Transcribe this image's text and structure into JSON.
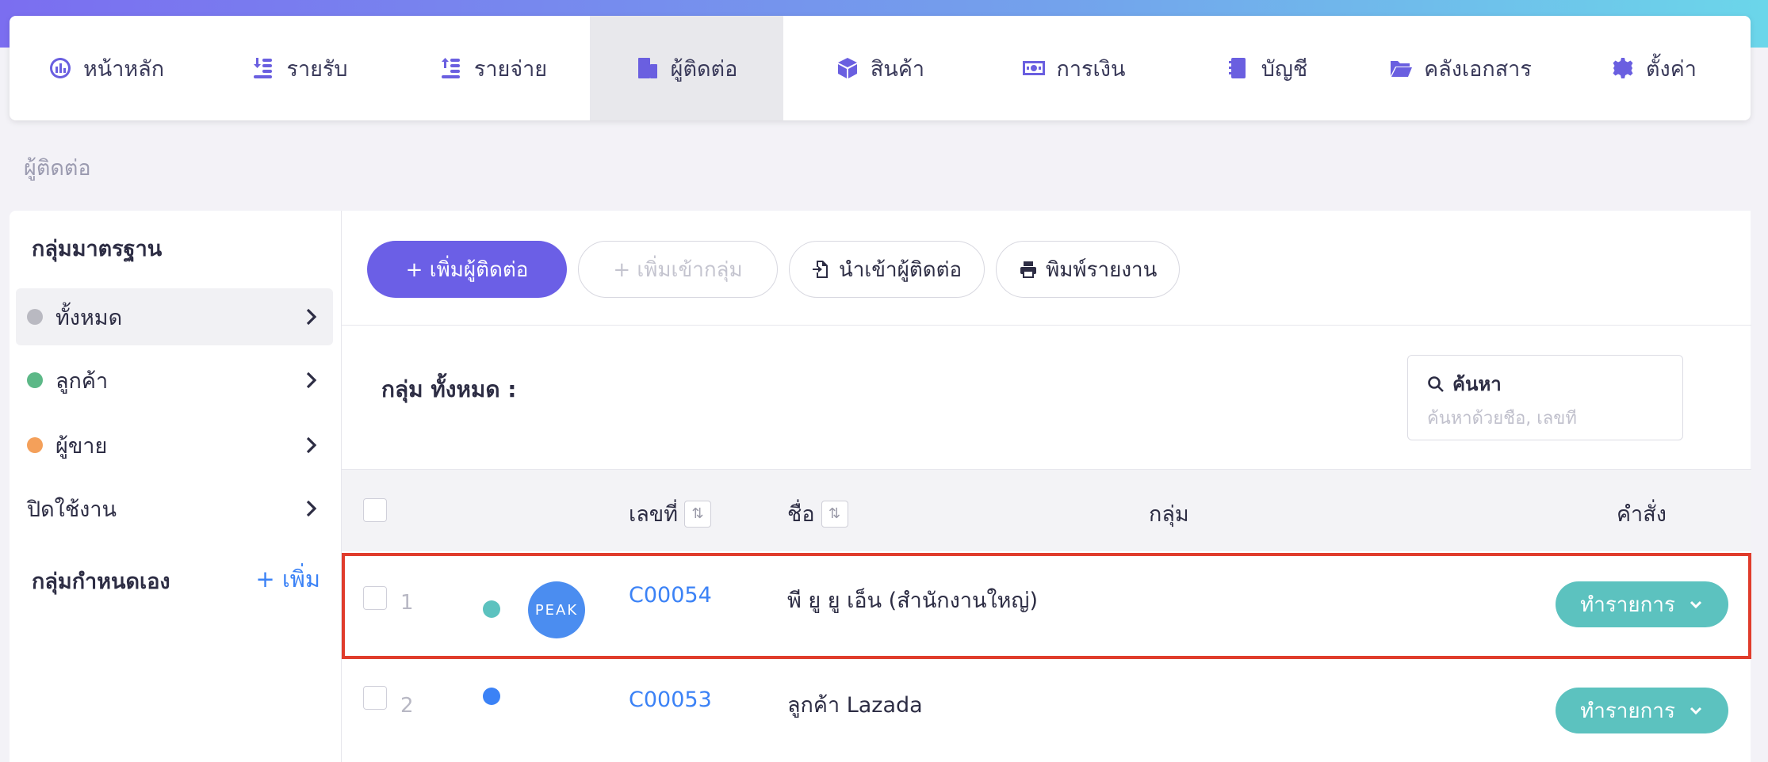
{
  "nav": {
    "items": [
      {
        "label": "หน้าหลัก",
        "icon": "dashboard-icon"
      },
      {
        "label": "รายรับ",
        "icon": "income-icon"
      },
      {
        "label": "รายจ่าย",
        "icon": "expense-icon"
      },
      {
        "label": "ผู้ติดต่อ",
        "icon": "contacts-icon",
        "active": true
      },
      {
        "label": "สินค้า",
        "icon": "box-icon"
      },
      {
        "label": "การเงิน",
        "icon": "money-icon"
      },
      {
        "label": "บัญชี",
        "icon": "ledger-icon"
      },
      {
        "label": "คลังเอกสาร",
        "icon": "folder-icon"
      },
      {
        "label": "ตั้งค่า",
        "icon": "gear-icon"
      }
    ],
    "accent_color": "#6a5fe0"
  },
  "breadcrumb": "ผู้ติดต่อ",
  "sidebar": {
    "standard_heading": "กลุ่มมาตรฐาน",
    "items": [
      {
        "label": "ทั้งหมด",
        "dot_color": "#b9b9c1"
      },
      {
        "label": "ลูกค้า",
        "dot_color": "#5cb887"
      },
      {
        "label": "ผู้ขาย",
        "dot_color": "#f4a05a"
      },
      {
        "label": "ปิดใช้งาน",
        "dot_color": ""
      }
    ],
    "custom_heading": "กลุ่มกำหนดเอง",
    "add_label": "+ เพิ่ม"
  },
  "toolbar": {
    "add_contact": "+ เพิ่มผู้ติดต่อ",
    "add_to_group": "+ เพิ่มเข้ากลุ่ม",
    "import_contacts": "นำเข้าผู้ติดต่อ",
    "print_report": "พิมพ์รายงาน"
  },
  "group_title": "กลุ่ม ทั้งหมด :",
  "search": {
    "label": "ค้นหา",
    "placeholder": "ค้นหาด้วยชื่อ, เลขที่"
  },
  "table": {
    "headers": {
      "code": "เลขที่",
      "name": "ชื่อ",
      "group": "กลุ่ม",
      "action": "คำสั่ง"
    },
    "rows": [
      {
        "num": "1",
        "dot_color": "#5cc2bf",
        "avatar": "PEAK",
        "code": "C00054",
        "name": "พี ยู ยู เอ็น (สำนักงานใหญ่)",
        "action": "ทำรายการ"
      },
      {
        "num": "2",
        "dot_color": "#3b82f6",
        "avatar": "",
        "code": "C00053",
        "name": "ลูกค้า Lazada",
        "action": "ทำรายการ"
      }
    ]
  }
}
